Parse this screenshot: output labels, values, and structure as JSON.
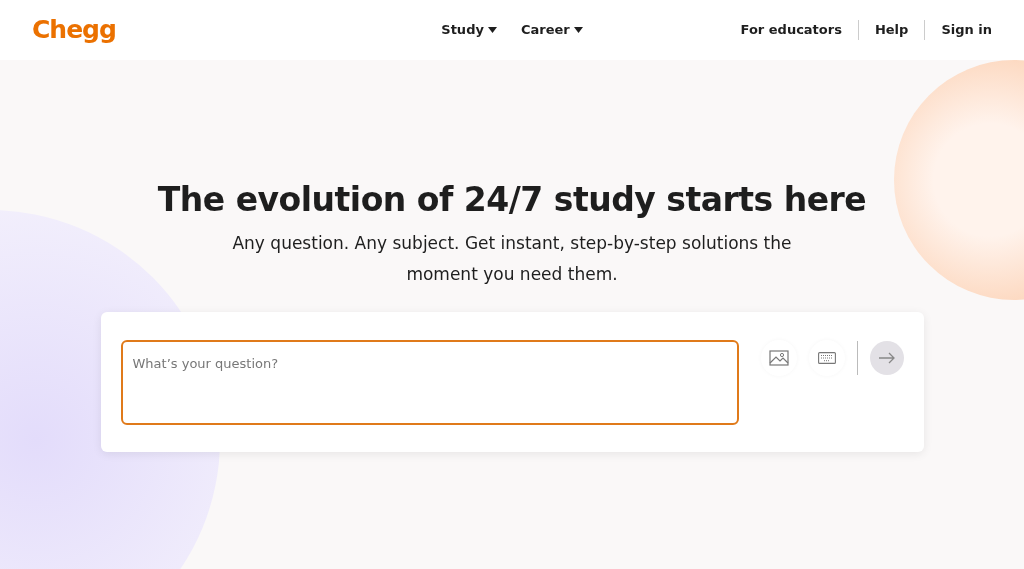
{
  "header": {
    "logo": "Chegg",
    "nav": [
      {
        "label": "Study",
        "has_menu": true
      },
      {
        "label": "Career",
        "has_menu": true
      }
    ],
    "links": [
      "For educators",
      "Help",
      "Sign in"
    ]
  },
  "hero": {
    "title": "The evolution of 24/7 study starts here",
    "subtitle": "Any question. Any subject. Get instant, step-by-step solutions the moment you need them.",
    "search": {
      "placeholder": "What’s your question?",
      "submit_disabled": true
    }
  }
}
